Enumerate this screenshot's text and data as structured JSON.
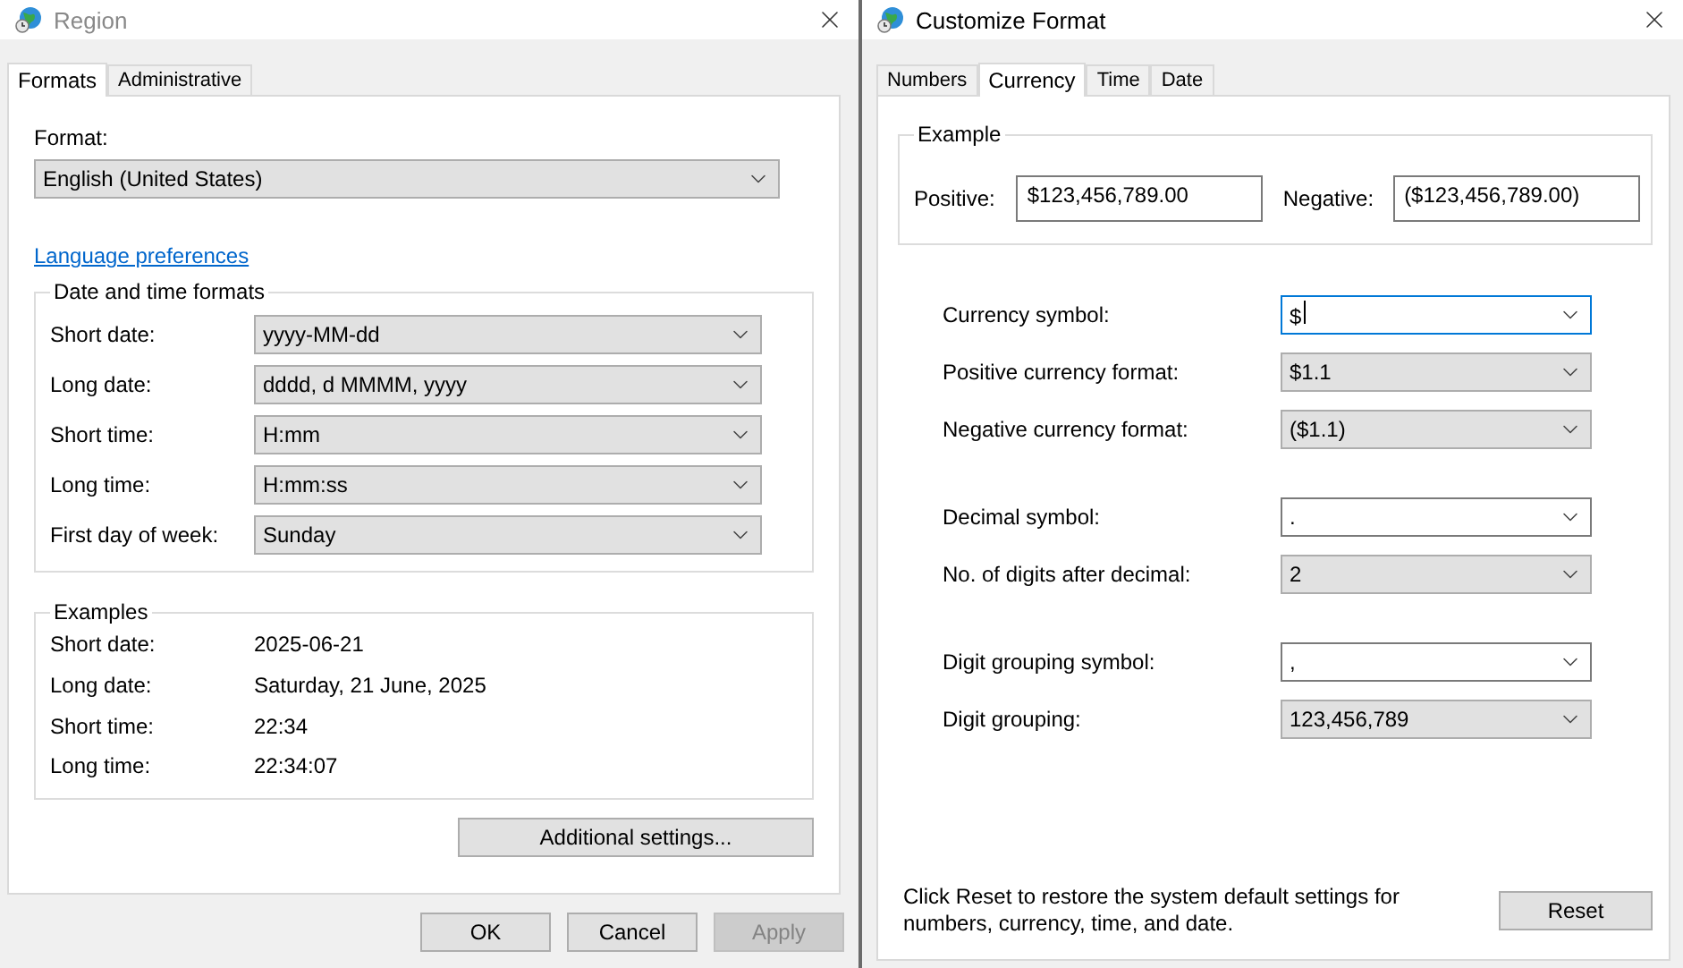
{
  "region_window": {
    "title": "Region",
    "active": false,
    "tabs": [
      {
        "label": "Formats",
        "selected": true
      },
      {
        "label": "Administrative",
        "selected": false
      }
    ],
    "format": {
      "label": "Format:",
      "value": "English (United States)"
    },
    "language_link": "Language preferences",
    "date_time_formats": {
      "title": "Date and time formats",
      "fields": [
        {
          "label": "Short date:",
          "value": "yyyy-MM-dd"
        },
        {
          "label": "Long date:",
          "value": "dddd, d MMMM, yyyy"
        },
        {
          "label": "Short time:",
          "value": "H:mm"
        },
        {
          "label": "Long time:",
          "value": "H:mm:ss"
        },
        {
          "label": "First day of week:",
          "value": "Sunday"
        }
      ]
    },
    "examples": {
      "title": "Examples",
      "rows": [
        {
          "label": "Short date:",
          "value": "2025-06-21"
        },
        {
          "label": "Long date:",
          "value": "Saturday, 21 June, 2025"
        },
        {
          "label": "Short time:",
          "value": "22:34"
        },
        {
          "label": "Long time:",
          "value": "22:34:07"
        }
      ]
    },
    "additional_button": "Additional settings...",
    "buttons": [
      {
        "label": "OK",
        "disabled": false
      },
      {
        "label": "Cancel",
        "disabled": false
      },
      {
        "label": "Apply",
        "disabled": true
      }
    ]
  },
  "customize_window": {
    "title": "Customize Format",
    "active": true,
    "tabs": [
      {
        "label": "Numbers",
        "selected": false
      },
      {
        "label": "Currency",
        "selected": true
      },
      {
        "label": "Time",
        "selected": false
      },
      {
        "label": "Date",
        "selected": false
      }
    ],
    "example": {
      "title": "Example",
      "positive": {
        "label": "Positive:",
        "value": "$123,456,789.00"
      },
      "negative": {
        "label": "Negative:",
        "value": "($123,456,789.00)"
      }
    },
    "field_groups": [
      {
        "fields": [
          {
            "label": "Currency symbol:",
            "value": "$",
            "kind": "edit",
            "focused": true
          },
          {
            "label": "Positive currency format:",
            "value": "$1.1",
            "kind": "list",
            "focused": false
          },
          {
            "label": "Negative currency format:",
            "value": "($1.1)",
            "kind": "list",
            "focused": false
          }
        ]
      },
      {
        "fields": [
          {
            "label": "Decimal symbol:",
            "value": ".",
            "kind": "edit",
            "focused": false
          },
          {
            "label": "No. of digits after decimal:",
            "value": "2",
            "kind": "list",
            "focused": false
          }
        ]
      },
      {
        "fields": [
          {
            "label": "Digit grouping symbol:",
            "value": ",",
            "kind": "edit",
            "focused": false
          },
          {
            "label": "Digit grouping:",
            "value": "123,456,789",
            "kind": "list",
            "focused": false
          }
        ]
      }
    ],
    "note": "Click Reset to restore the system default settings for numbers, currency, time, and date.",
    "reset_button": "Reset"
  }
}
